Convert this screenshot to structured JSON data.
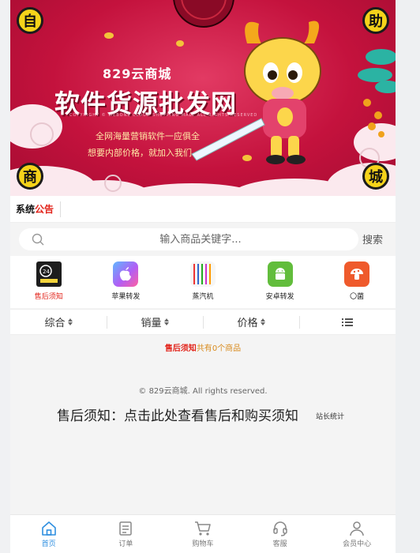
{
  "banner": {
    "corners": [
      "自",
      "助",
      "商",
      "城"
    ],
    "logo": "829云商城",
    "title": "软件货源批发网",
    "copyright": "COPYRIGHT © WEBONE CLOUD SHOPPING MALL ALL RIGHTS RESERVED",
    "slogan1": "全网海量营销软件一应俱全",
    "slogan2": "想要内部价格，就加入我们"
  },
  "notice": {
    "title_plain": "系统",
    "title_highlight": "公告"
  },
  "search": {
    "placeholder": "输入商品关键字...",
    "button": "搜索"
  },
  "categories": [
    {
      "label": "售后须知",
      "icon": "after-sales-icon",
      "active": true
    },
    {
      "label": "苹果转发",
      "icon": "apple-icon",
      "active": false
    },
    {
      "label": "蒸汽机",
      "icon": "steam-engine-icon",
      "active": false
    },
    {
      "label": "安卓转发",
      "icon": "android-icon",
      "active": false
    },
    {
      "label": "〇菌",
      "icon": "mushroom-icon",
      "active": false
    }
  ],
  "sort": {
    "items": [
      "综合",
      "销量",
      "价格"
    ]
  },
  "results": {
    "category": "售后须知",
    "prefix": "共有",
    "count": "0",
    "suffix": "个商品"
  },
  "footer": {
    "copyright": "© 829云商城. All rights reserved.",
    "notice_link": "售后须知：点击此处查看售后和购买须知",
    "stats": "站长统计"
  },
  "tabbar": [
    {
      "label": "首页",
      "icon": "home-icon",
      "active": true
    },
    {
      "label": "订单",
      "icon": "order-icon",
      "active": false
    },
    {
      "label": "购物车",
      "icon": "cart-icon",
      "active": false
    },
    {
      "label": "客服",
      "icon": "headset-icon",
      "active": false
    },
    {
      "label": "会员中心",
      "icon": "user-icon",
      "active": false
    }
  ],
  "colors": {
    "accent": "#e2231a",
    "tab_active": "#2f8fe0",
    "banner": "#c4123d"
  }
}
